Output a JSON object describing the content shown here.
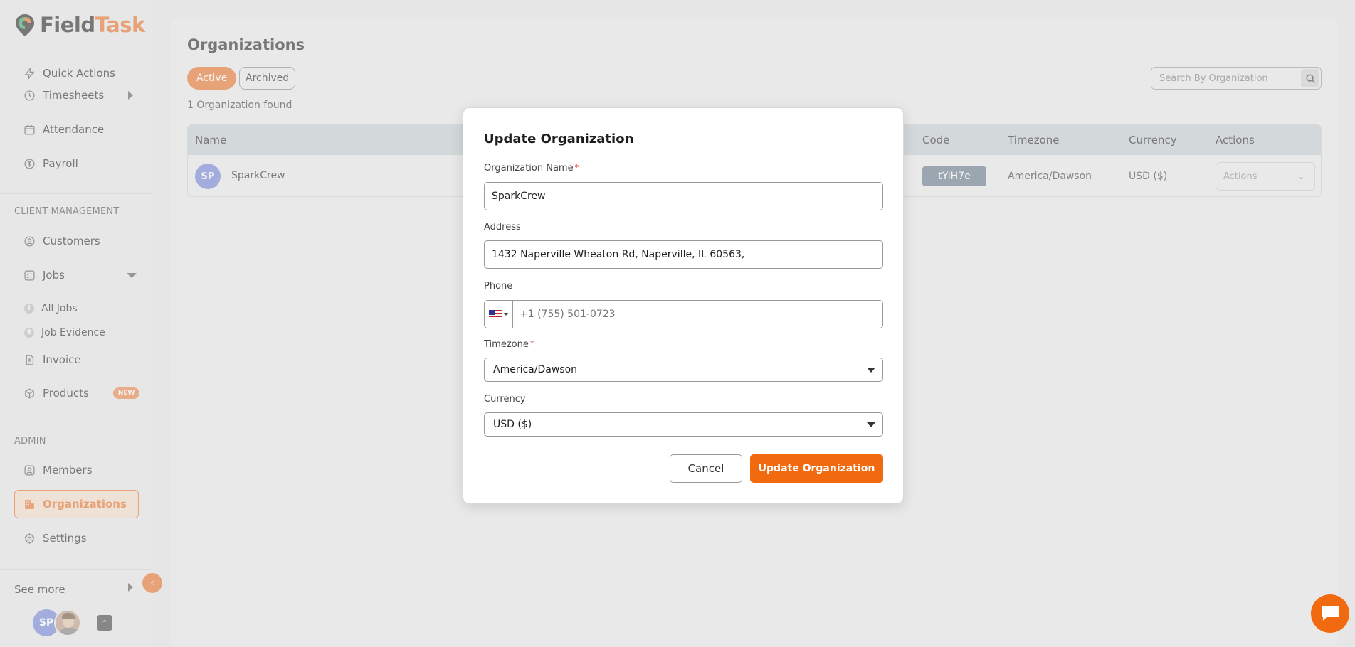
{
  "brand": {
    "name_part1": "Field",
    "name_part2": "Task"
  },
  "sidebar": {
    "top_items": [
      {
        "label": "Quick Actions"
      },
      {
        "label": "Timesheets"
      },
      {
        "label": "Attendance"
      },
      {
        "label": "Payroll"
      }
    ],
    "client_section": "CLIENT MANAGEMENT",
    "client_items": [
      {
        "label": "Customers"
      },
      {
        "label": "Jobs"
      }
    ],
    "jobs_sub": [
      {
        "label": "All Jobs"
      },
      {
        "label": "Job Evidence"
      }
    ],
    "more_items": [
      {
        "label": "Invoice"
      },
      {
        "label": "Products",
        "badge": "NEW"
      }
    ],
    "admin_section": "ADMIN",
    "admin_items": [
      {
        "label": "Members"
      },
      {
        "label": "Organizations"
      },
      {
        "label": "Settings"
      }
    ],
    "see_more": "See more",
    "user_initials": "SP"
  },
  "main": {
    "title": "Organizations",
    "tabs": {
      "active": "Active",
      "archived": "Archived"
    },
    "found_text": "1 Organization found",
    "search_placeholder": "Search By Organization",
    "table": {
      "headers": {
        "name": "Name",
        "code": "Code",
        "timezone": "Timezone",
        "currency": "Currency",
        "actions": "Actions"
      },
      "rows": [
        {
          "initials": "SP",
          "name": "SparkCrew",
          "code": "tYiH7e",
          "timezone": "America/Dawson",
          "currency": "USD ($)",
          "actions": "Actions"
        }
      ]
    }
  },
  "modal": {
    "title": "Update Organization",
    "org_name_label": "Organization Name",
    "org_name_value": "SparkCrew",
    "address_label": "Address",
    "address_value": "1432 Naperville Wheaton Rd, Naperville, IL 60563,",
    "phone_label": "Phone",
    "phone_placeholder": "+1 (755) 501-0723",
    "timezone_label": "Timezone",
    "timezone_value": "America/Dawson",
    "currency_label": "Currency",
    "currency_value": "USD ($)",
    "cancel_label": "Cancel",
    "submit_label": "Update Organization",
    "required_mark": "*"
  },
  "colors": {
    "accent": "#ea6a1e",
    "code_badge": "#5e7283",
    "avatar": "#6a7fd6"
  }
}
